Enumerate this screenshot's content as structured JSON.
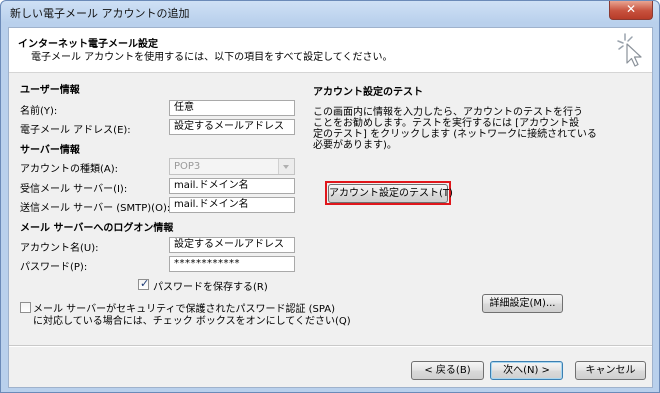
{
  "window": {
    "title": "新しい電子メール アカウントの追加",
    "close_glyph": "✕"
  },
  "header": {
    "title": "インターネット電子メール設定",
    "subtitle": "電子メール アカウントを使用するには、以下の項目をすべて設定してください。",
    "icon": "wizard-cursor-icon"
  },
  "user_info": {
    "section": "ユーザー情報",
    "name_label": "名前(Y):",
    "name_value": "任意",
    "email_label": "電子メール アドレス(E):",
    "email_value": "設定するメールアドレス"
  },
  "server_info": {
    "section": "サーバー情報",
    "account_type_label": "アカウントの種類(A):",
    "account_type_value": "POP3",
    "incoming_label": "受信メール サーバー(I):",
    "incoming_value": "mail.ドメイン名",
    "outgoing_label": "送信メール サーバー (SMTP)(O):",
    "outgoing_value": "mail.ドメイン名"
  },
  "logon_info": {
    "section": "メール サーバーへのログオン情報",
    "account_label": "アカウント名(U):",
    "account_value": "設定するメールアドレス",
    "password_label": "パスワード(P):",
    "password_value": "************",
    "remember_label": "パスワードを保存する(R)",
    "remember_checked": true,
    "spa_label_line1": "メール サーバーがセキュリティで保護されたパスワード認証 (SPA)",
    "spa_label_line2": "に対応している場合には、チェック ボックスをオンにしてください(Q)",
    "spa_checked": false
  },
  "test": {
    "section": "アカウント設定のテスト",
    "desc_line1": "この画面内に情報を入力したら、アカウントのテストを行う",
    "desc_line2": "ことをお勧めします。テストを実行するには [アカウント設",
    "desc_line3": "定のテスト] をクリックします (ネットワークに接続されている",
    "desc_line4": "必要があります)。",
    "button": "アカウント設定のテスト(T)",
    "highlight_color": "#e0161b"
  },
  "advanced_button": "詳細設定(M)...",
  "footer": {
    "back": "< 戻る(B)",
    "next": "次へ(N) >",
    "cancel": "キャンセル"
  }
}
